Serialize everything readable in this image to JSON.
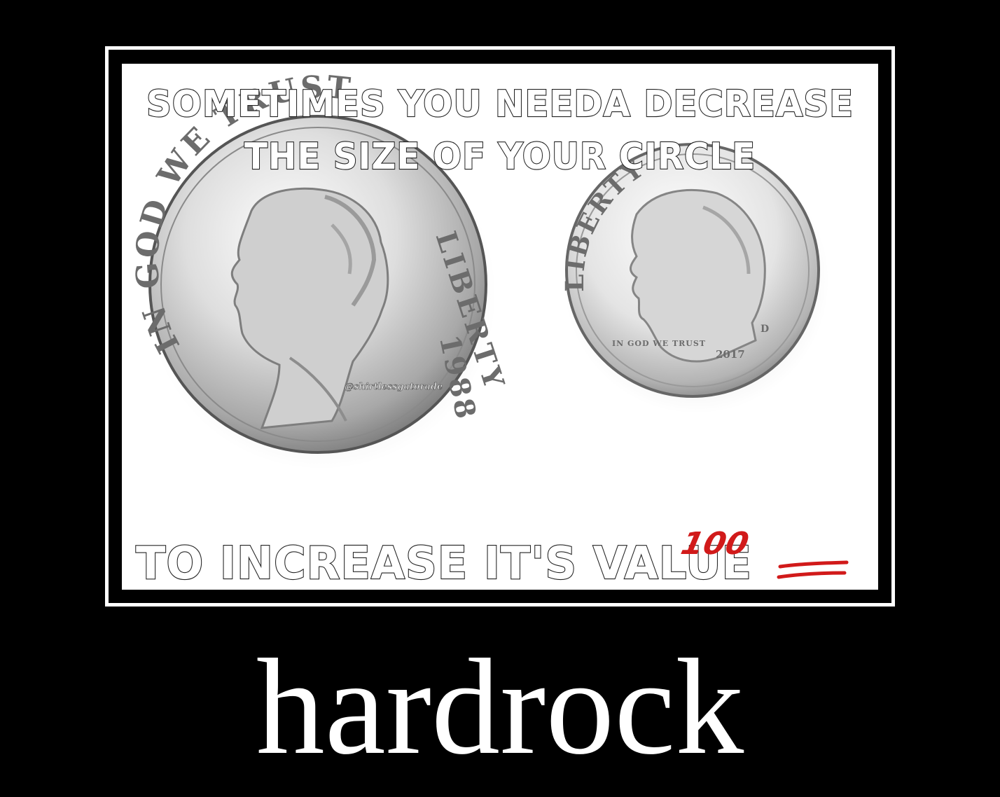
{
  "meme": {
    "top_line_1": "SOMETIMES YOU NEEDA DECREASE",
    "top_line_2": "THE SIZE OF YOUR CIRCLE",
    "bottom_line": "TO INCREASE IT'S VALUE",
    "emoji": "100",
    "nickel": {
      "motto": "IN GOD WE TRUST",
      "liberty": "LIBERTY",
      "year": "1988"
    },
    "dime": {
      "liberty": "LIBERTY",
      "motto": "IN GOD WE TRUST",
      "year": "2017",
      "mint": "D"
    },
    "watermark": "@shirtlessgatorade"
  },
  "caption": {
    "text": "hardrock"
  },
  "colors": {
    "background": "#000000",
    "frame": "#ffffff",
    "emoji_red": "#d11a1a"
  },
  "icons": {
    "nickel": "nickel-coin-icon",
    "dime": "dime-coin-icon",
    "hundred": "hundred-points-emoji-icon"
  }
}
